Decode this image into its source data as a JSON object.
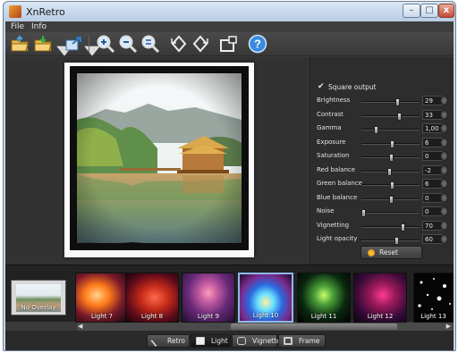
{
  "window": {
    "title": "XnRetro",
    "min_glyph": "–",
    "max_glyph": "□",
    "close_glyph": "x"
  },
  "menu": [
    "File",
    "Info"
  ],
  "toolbar": {
    "icons": [
      "open-folder-icon",
      "save-folder-icon",
      "export-icon",
      "zoom-in-icon",
      "zoom-out-icon",
      "zoom-fit-icon",
      "rotate-left-icon",
      "rotate-right-icon",
      "share-icon",
      "help-icon"
    ]
  },
  "panel": {
    "square_output_check": "✔",
    "square_output_label": "Square output",
    "square_output_checked": true,
    "sliders": [
      {
        "label": "Brightness",
        "value": "29",
        "position": 0.62
      },
      {
        "label": "Contrast",
        "value": "33",
        "position": 0.64
      },
      {
        "label": "Gamma",
        "value": "1,00",
        "position": 0.25
      },
      {
        "label": "Exposure",
        "value": "6",
        "position": 0.53
      },
      {
        "label": "Saturation",
        "value": "0",
        "position": 0.5
      },
      {
        "label": "Red balance",
        "value": "-2",
        "position": 0.48
      },
      {
        "label": "Green balance",
        "value": "6",
        "position": 0.53
      },
      {
        "label": "Blue balance",
        "value": "0",
        "position": 0.5
      },
      {
        "label": "Noise",
        "value": "0",
        "position": 0.03
      },
      {
        "label": "Vignetting",
        "value": "70",
        "position": 0.7
      },
      {
        "label": "Light opacity",
        "value": "60",
        "position": 0.6
      }
    ],
    "reset_label": "Reset"
  },
  "filmstrip": {
    "items": [
      {
        "label": "No Overlay"
      },
      {
        "label": "Light 7"
      },
      {
        "label": "Light 8"
      },
      {
        "label": "Light 9"
      },
      {
        "label": "Light 10",
        "selected": true
      },
      {
        "label": "Light 11"
      },
      {
        "label": "Light 12"
      },
      {
        "label": "Light 13"
      }
    ],
    "scroll_left": "◀",
    "scroll_right": "▶"
  },
  "tabs": [
    {
      "label": "Retro"
    },
    {
      "label": "Light",
      "active": true
    },
    {
      "label": "Vignette"
    },
    {
      "label": "Frame"
    }
  ],
  "colors": {
    "background": "#3a3a3a",
    "panel": "#2d2d2d",
    "selected_thumb_border": "#8fb8e8",
    "reset_icon": "#f0a020"
  }
}
